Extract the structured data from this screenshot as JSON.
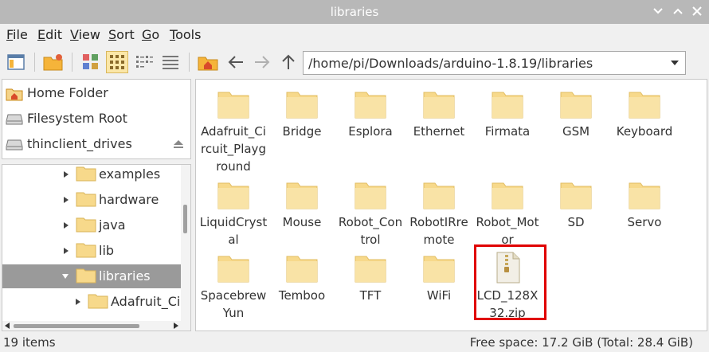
{
  "window": {
    "title": "libraries"
  },
  "menu": [
    {
      "label": "File"
    },
    {
      "label": "Edit"
    },
    {
      "label": "View"
    },
    {
      "label": "Sort"
    },
    {
      "label": "Go"
    },
    {
      "label": "Tools"
    }
  ],
  "location": {
    "path": "/home/pi/Downloads/arduino-1.8.19/libraries"
  },
  "places": [
    {
      "label": "Home Folder",
      "icon": "home-icon"
    },
    {
      "label": "Filesystem Root",
      "icon": "drive-icon"
    },
    {
      "label": "thinclient_drives",
      "icon": "drive-icon"
    }
  ],
  "tree": [
    {
      "label": "examples",
      "expanded": false
    },
    {
      "label": "hardware",
      "expanded": false
    },
    {
      "label": "java",
      "expanded": false
    },
    {
      "label": "lib",
      "expanded": false
    },
    {
      "label": "libraries",
      "expanded": true,
      "selected": true
    },
    {
      "label": "Adafruit_Circ",
      "expanded": false
    }
  ],
  "files": [
    {
      "label": "Adafruit_Circuit_Playground",
      "type": "folder"
    },
    {
      "label": "Bridge",
      "type": "folder"
    },
    {
      "label": "Esplora",
      "type": "folder"
    },
    {
      "label": "Ethernet",
      "type": "folder"
    },
    {
      "label": "Firmata",
      "type": "folder"
    },
    {
      "label": "GSM",
      "type": "folder"
    },
    {
      "label": "Keyboard",
      "type": "folder"
    },
    {
      "label": "LiquidCrystal",
      "type": "folder"
    },
    {
      "label": "Mouse",
      "type": "folder"
    },
    {
      "label": "Robot_Control",
      "type": "folder"
    },
    {
      "label": "RobotIRremote",
      "type": "folder"
    },
    {
      "label": "Robot_Motor",
      "type": "folder"
    },
    {
      "label": "SD",
      "type": "folder"
    },
    {
      "label": "Servo",
      "type": "folder"
    },
    {
      "label": "SpacebrewYun",
      "type": "folder"
    },
    {
      "label": "Temboo",
      "type": "folder"
    },
    {
      "label": "TFT",
      "type": "folder"
    },
    {
      "label": "WiFi",
      "type": "folder"
    },
    {
      "label": "LCD_128X32.zip",
      "type": "zip",
      "highlighted": true
    }
  ],
  "status": {
    "items": "19 items",
    "free_space": "Free space: 17.2 GiB (Total: 28.4 GiB)"
  },
  "colors": {
    "folder": "#f7d98b",
    "highlight": "#e00000",
    "selected_row": "#9a9a9a"
  }
}
